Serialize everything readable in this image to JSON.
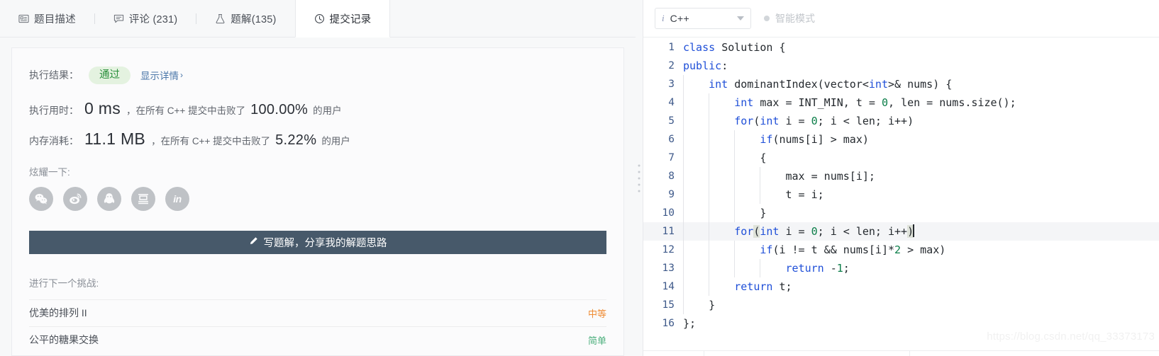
{
  "tabs": [
    {
      "label": "题目描述",
      "icon": "description-icon",
      "active": false
    },
    {
      "label": "评论 (231)",
      "icon": "comment-icon",
      "active": false
    },
    {
      "label": "题解(135)",
      "icon": "flask-icon",
      "active": false
    },
    {
      "label": "提交记录",
      "icon": "clock-icon",
      "active": true
    }
  ],
  "result": {
    "label": "执行结果：",
    "status": "通过",
    "detail_link": "显示详情",
    "detail_chevron": "›",
    "status_color": "#2a8f3c",
    "status_bg": "#dff0d8"
  },
  "stats": [
    {
      "key": "执行用时：",
      "value": "0 ms",
      "middle": "，在所有 C++ 提交中击败了",
      "percent": "100.00%",
      "tail": "的用户"
    },
    {
      "key": "内存消耗：",
      "value": "11.1 MB",
      "middle": "，在所有 C++ 提交中击败了",
      "percent": "5.22%",
      "tail": "的用户"
    }
  ],
  "share": {
    "title": "炫耀一下:",
    "icons": [
      {
        "name": "wechat-icon"
      },
      {
        "name": "weibo-icon"
      },
      {
        "name": "qq-icon"
      },
      {
        "name": "douban-icon"
      },
      {
        "name": "linkedin-icon",
        "text": "in"
      }
    ]
  },
  "write_button": {
    "icon": "pencil-icon",
    "label": "写题解，分享我的解题思路",
    "bg": "#47596a"
  },
  "next_challenge": {
    "title": "进行下一个挑战:",
    "items": [
      {
        "title": "优美的排列 II",
        "difficulty": "中等",
        "color": "#ef8b33"
      },
      {
        "title": "公平的糖果交换",
        "difficulty": "简单",
        "color": "#4caf7d"
      }
    ]
  },
  "editor": {
    "language": "C++",
    "language_icon": "info-italic-icon",
    "caret_icon": "chevron-down-icon",
    "smart_mode": "智能模式",
    "smart_mode_enabled": false,
    "watermark": "https://blog.csdn.net/qq_33373173",
    "active_line": 11,
    "lines": [
      {
        "n": "1",
        "indent": 0,
        "tokens": [
          {
            "t": "class ",
            "c": "kw"
          },
          {
            "t": "Solution {",
            "c": "blk"
          }
        ]
      },
      {
        "n": "2",
        "indent": 0,
        "tokens": [
          {
            "t": "public",
            "c": "kw"
          },
          {
            "t": ":",
            "c": "blk"
          }
        ]
      },
      {
        "n": "3",
        "indent": 1,
        "tokens": [
          {
            "t": "    ",
            "c": "blk"
          },
          {
            "t": "int",
            "c": "kw"
          },
          {
            "t": " dominantIndex(vector<",
            "c": "blk"
          },
          {
            "t": "int",
            "c": "kw"
          },
          {
            "t": ">& nums) {",
            "c": "blk"
          }
        ]
      },
      {
        "n": "4",
        "indent": 2,
        "tokens": [
          {
            "t": "        ",
            "c": "blk"
          },
          {
            "t": "int",
            "c": "kw"
          },
          {
            "t": " max = INT_MIN, t = ",
            "c": "blk"
          },
          {
            "t": "0",
            "c": "num"
          },
          {
            "t": ", len = nums.size();",
            "c": "blk"
          }
        ]
      },
      {
        "n": "5",
        "indent": 2,
        "tokens": [
          {
            "t": "        ",
            "c": "blk"
          },
          {
            "t": "for",
            "c": "kw"
          },
          {
            "t": "(",
            "c": "blk"
          },
          {
            "t": "int",
            "c": "kw"
          },
          {
            "t": " i = ",
            "c": "blk"
          },
          {
            "t": "0",
            "c": "num"
          },
          {
            "t": "; i < len; i++)",
            "c": "blk"
          }
        ]
      },
      {
        "n": "6",
        "indent": 3,
        "tokens": [
          {
            "t": "            ",
            "c": "blk"
          },
          {
            "t": "if",
            "c": "kw"
          },
          {
            "t": "(nums[i] > max)",
            "c": "blk"
          }
        ]
      },
      {
        "n": "7",
        "indent": 3,
        "tokens": [
          {
            "t": "            {",
            "c": "blk"
          }
        ]
      },
      {
        "n": "8",
        "indent": 4,
        "tokens": [
          {
            "t": "                max = nums[i];",
            "c": "blk"
          }
        ]
      },
      {
        "n": "9",
        "indent": 4,
        "tokens": [
          {
            "t": "                t = i;",
            "c": "blk"
          }
        ]
      },
      {
        "n": "10",
        "indent": 3,
        "tokens": [
          {
            "t": "            }",
            "c": "blk"
          }
        ]
      },
      {
        "n": "11",
        "indent": 2,
        "tokens": [
          {
            "t": "        ",
            "c": "blk"
          },
          {
            "t": "for",
            "c": "kw"
          },
          {
            "t": "(",
            "c": "brkt"
          },
          {
            "t": "int",
            "c": "kw"
          },
          {
            "t": " i = ",
            "c": "blk"
          },
          {
            "t": "0",
            "c": "num"
          },
          {
            "t": "; i < len; i++",
            "c": "blk"
          },
          {
            "t": ")",
            "c": "brkt"
          },
          {
            "t": "",
            "c": "caret"
          }
        ]
      },
      {
        "n": "12",
        "indent": 3,
        "tokens": [
          {
            "t": "            ",
            "c": "blk"
          },
          {
            "t": "if",
            "c": "kw"
          },
          {
            "t": "(i != t && nums[i]*",
            "c": "blk"
          },
          {
            "t": "2",
            "c": "num"
          },
          {
            "t": " > max)",
            "c": "blk"
          }
        ]
      },
      {
        "n": "13",
        "indent": 4,
        "tokens": [
          {
            "t": "                ",
            "c": "blk"
          },
          {
            "t": "return",
            "c": "kw"
          },
          {
            "t": " -",
            "c": "blk"
          },
          {
            "t": "1",
            "c": "num"
          },
          {
            "t": ";",
            "c": "blk"
          }
        ]
      },
      {
        "n": "14",
        "indent": 2,
        "tokens": [
          {
            "t": "        ",
            "c": "blk"
          },
          {
            "t": "return",
            "c": "kw"
          },
          {
            "t": " t;",
            "c": "blk"
          }
        ]
      },
      {
        "n": "15",
        "indent": 1,
        "tokens": [
          {
            "t": "    }",
            "c": "blk"
          }
        ]
      },
      {
        "n": "16",
        "indent": 0,
        "tokens": [
          {
            "t": "};",
            "c": "blk"
          }
        ]
      }
    ]
  }
}
